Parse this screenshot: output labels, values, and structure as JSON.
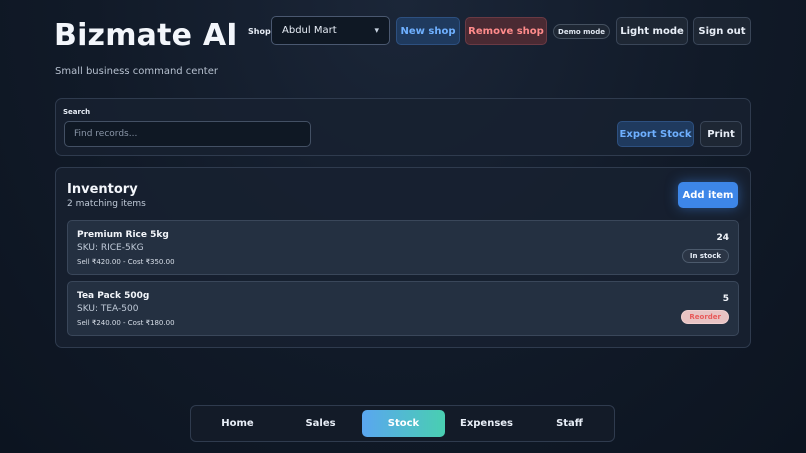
{
  "brand": {
    "title": "Bizmate AI",
    "subtitle": "Small business command center"
  },
  "header": {
    "shop_label": "Shop",
    "shop_value": "Abdul Mart",
    "new_shop": "New shop",
    "remove_shop": "Remove shop",
    "demo_mode": "Demo mode",
    "light_mode": "Light mode",
    "sign_out": "Sign out"
  },
  "search": {
    "label": "Search",
    "placeholder": "Find records...",
    "value": "",
    "export_label": "Export Stock",
    "print_label": "Print"
  },
  "inventory": {
    "title": "Inventory",
    "count": "2 matching items",
    "add_label": "Add item",
    "items": [
      {
        "name": "Premium Rice 5kg",
        "sku": "SKU: RICE-5KG",
        "price": "Sell ₹420.00 - Cost ₹350.00",
        "qty": "24",
        "status": "In stock"
      },
      {
        "name": "Tea Pack 500g",
        "sku": "SKU: TEA-500",
        "price": "Sell ₹240.00 - Cost ₹180.00",
        "qty": "5",
        "status": "Reorder"
      }
    ]
  },
  "nav": {
    "tabs": [
      {
        "label": "Home"
      },
      {
        "label": "Sales"
      },
      {
        "label": "Stock"
      },
      {
        "label": "Expenses"
      },
      {
        "label": "Staff"
      }
    ],
    "active": "Stock"
  },
  "colors": {
    "accent": "#3d86e8",
    "danger": "#ff8b8b",
    "nav_active_start": "#5aa6f0",
    "nav_active_end": "#49cfb1"
  }
}
